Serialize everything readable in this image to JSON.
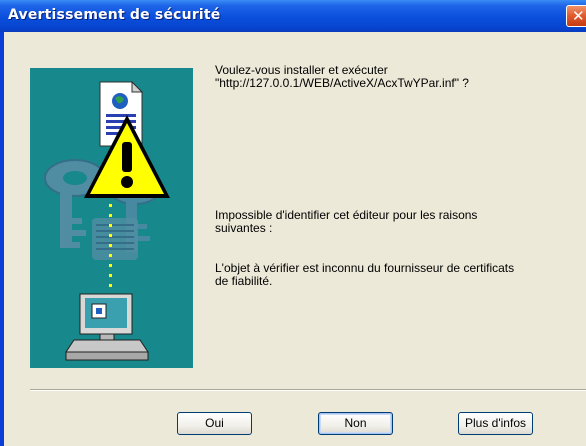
{
  "window": {
    "title": "Avertissement de sécurité",
    "close_icon": "close-icon"
  },
  "message": {
    "line1": "Voulez-vous installer et exécuter",
    "line2": "\"http://127.0.0.1/WEB/ActiveX/AcxTwYPar.inf\" ?",
    "publisher_line1": "Impossible d'identifier cet éditeur pour les raisons",
    "publisher_line2": "suivantes :",
    "reason_line1": "L'objet à vérifier est inconnu du fournisseur de certificats",
    "reason_line2": "de fiabilité."
  },
  "buttons": {
    "yes": "Oui",
    "no": "Non",
    "more": "Plus d'infos"
  },
  "colors": {
    "titlebar": "#0a4fdc",
    "illustration_bg": "#17888c",
    "dialog_bg": "#ece9d8",
    "warning_yellow": "#ffff00"
  },
  "icons": [
    "document-icon",
    "warning-icon",
    "keys-icon",
    "computer-icon"
  ]
}
